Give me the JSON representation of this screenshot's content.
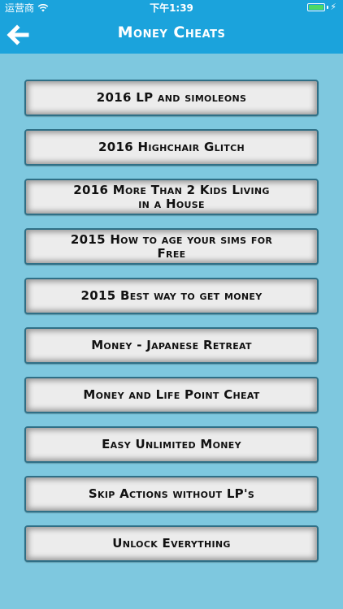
{
  "status_bar": {
    "carrier": "运营商",
    "time": "下午1:39",
    "battery_level": 1.0,
    "colors": {
      "battery": "#4cd964"
    }
  },
  "nav": {
    "title": "Money Cheats",
    "back_icon": "arrow-left-icon"
  },
  "colors": {
    "header": "#1ba3dc",
    "background": "#7ec8df",
    "button_face": "#ececec",
    "button_border": "#2f6f86"
  },
  "items": [
    {
      "label": "2016 LP and simoleons"
    },
    {
      "label": "2016 Highchair Glitch"
    },
    {
      "label": "2016 More Than 2 Kids Living in a House"
    },
    {
      "label": "2015 How to age your sims for Free"
    },
    {
      "label": "2015 Best way to get money"
    },
    {
      "label": "Money - Japanese Retreat"
    },
    {
      "label": "Money and Life Point Cheat"
    },
    {
      "label": "Easy Unlimited Money"
    },
    {
      "label": "Skip Actions without LP's"
    },
    {
      "label": "Unlock Everything"
    }
  ]
}
